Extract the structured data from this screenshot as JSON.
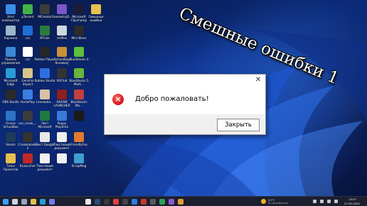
{
  "overlay_title": "Смешные ошибки 1",
  "dialog": {
    "message": "Добро пожаловать!",
    "ok_label": "Закрыть",
    "close_glyph": "✕",
    "icon": "error-icon"
  },
  "desktop_icons": [
    {
      "label": "Этот компьютер",
      "color": "#3a8ee6"
    },
    {
      "label": "µTorrent",
      "color": "#44b24a"
    },
    {
      "label": "MCreator",
      "color": "#3b3b3b"
    },
    {
      "label": "GeometryD...",
      "color": "#7a56c9"
    },
    {
      "label": "Microsoft Clipchamp",
      "color": "#1b1b3a"
    },
    {
      "label": "Смешные ошибки",
      "color": "#e8c050"
    },
    {
      "label": "Корзина",
      "color": "#9bb7cc"
    },
    {
      "label": "ccc",
      "color": "#1e6fd4"
    },
    {
      "label": "NTLite",
      "color": "#2a7b3c"
    },
    {
      "label": "redflex",
      "color": "#cfd7de"
    },
    {
      "label": "Mini Bloxs",
      "color": "#2b2b2b"
    },
    {
      "label": "",
      "color": "#000000"
    },
    {
      "label": "Панель управления",
      "color": "#3b8ad6"
    },
    {
      "label": "ccc",
      "color": "#ffffff"
    },
    {
      "label": "Roblox Player",
      "color": "#262626"
    },
    {
      "label": "SchoolBoy Runaway",
      "color": "#c9913a"
    },
    {
      "label": "BlueStacks X",
      "color": "#5cbf3a"
    },
    {
      "label": "",
      "color": "#000000"
    },
    {
      "label": "Microsoft Edge",
      "color": "#2a9bd8"
    },
    {
      "label": "Genshin Impact",
      "color": "#d7c48a"
    },
    {
      "label": "Roblox Studio",
      "color": "#2c6fe0"
    },
    {
      "label": "VRChat",
      "color": "#333333"
    },
    {
      "label": "BlueStacks 5 Multi...",
      "color": "#68b43c"
    },
    {
      "label": "",
      "color": "#000000"
    },
    {
      "label": "OBS Studio",
      "color": "#2b2b2b"
    },
    {
      "label": "HorloPlay",
      "color": "#3c7de0"
    },
    {
      "label": "Lesnaeda...",
      "color": "#d8c0a4"
    },
    {
      "label": "RAZAM LAUNCHER",
      "color": "#8c2020"
    },
    {
      "label": "BlueStacks Mu...",
      "color": "#c04040"
    },
    {
      "label": "",
      "color": "#000000"
    },
    {
      "label": "Oracle VirtualBox",
      "color": "#2e74c9"
    },
    {
      "label": "con_mask_...",
      "color": "#3c3c3c"
    },
    {
      "label": "Лист Microsoft",
      "color": "#1e7a43"
    },
    {
      "label": "Poppy Playtime",
      "color": "#3a7bd8"
    },
    {
      "label": "",
      "color": "#1a1a1a"
    },
    {
      "label": "",
      "color": "#000000"
    },
    {
      "label": "Steam",
      "color": "#1f3a5c"
    },
    {
      "label": "Cmakeloader 2",
      "color": "#333333"
    },
    {
      "label": "Лист Google",
      "color": "#e8e8e8"
    },
    {
      "label": "Текстовый документ",
      "color": "#f0f0f0"
    },
    {
      "label": "FriendlyFox",
      "color": "#e07a2e"
    },
    {
      "label": "",
      "color": "#000000"
    },
    {
      "label": "Типы Проектов",
      "color": "#e8c050"
    },
    {
      "label": "KLauncher",
      "color": "#c02828"
    },
    {
      "label": "Текстовый документ",
      "color": "#f0f0f0"
    },
    {
      "label": "",
      "color": "#f0f0f0"
    },
    {
      "label": "ScrapMag",
      "color": "#3fa0d0"
    },
    {
      "label": "",
      "color": "#000000"
    }
  ],
  "taskbar": {
    "weather_temp": "20°C",
    "weather_condition": "Вз.малооблачно",
    "time": "13:57",
    "date": "27.05.2025",
    "icons": [
      {
        "name": "start-icon",
        "color": "#3aa0ff"
      },
      {
        "name": "search-icon",
        "color": "#cfd4e0"
      },
      {
        "name": "task-view-icon",
        "color": "#9aa3b8"
      },
      {
        "name": "explorer-icon",
        "color": "#e8c050"
      },
      {
        "name": "edge-icon",
        "color": "#2a9bd8"
      },
      {
        "name": "store-icon",
        "color": "#6f7cf0"
      },
      {
        "name": "yandex-icon",
        "color": "#e8e8e8"
      },
      {
        "name": "steam-icon",
        "color": "#2b4d78"
      },
      {
        "name": "app-icon",
        "color": "#3a3a3a"
      },
      {
        "name": "chrome-icon",
        "color": "#e04040"
      },
      {
        "name": "obs-icon",
        "color": "#444444"
      },
      {
        "name": "app-icon",
        "color": "#2f7ae0"
      },
      {
        "name": "app-icon",
        "color": "#c53a2a"
      },
      {
        "name": "app-icon",
        "color": "#5a5a5a"
      },
      {
        "name": "app-icon",
        "color": "#2aa05a"
      },
      {
        "name": "app-icon",
        "color": "#8a5ad6"
      },
      {
        "name": "app-icon",
        "color": "#e0a030"
      }
    ]
  }
}
